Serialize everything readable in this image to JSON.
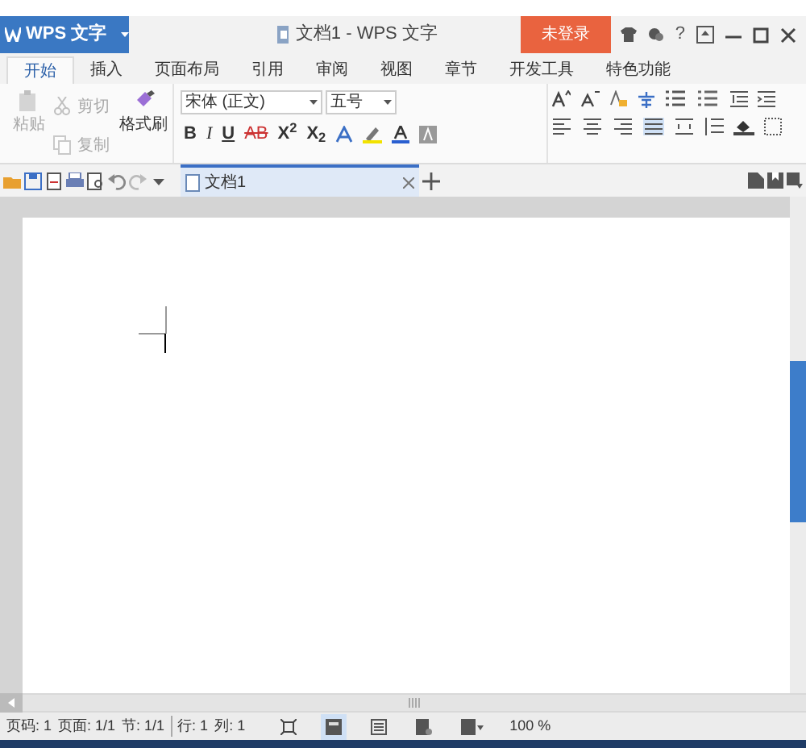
{
  "app_menu": {
    "label": "WPS 文字"
  },
  "window": {
    "title": "文档1 - WPS 文字"
  },
  "login_button": {
    "label": "未登录"
  },
  "help": {
    "label": "?"
  },
  "tabs": [
    {
      "label": "开始",
      "selected": true
    },
    {
      "label": "插入",
      "selected": false
    },
    {
      "label": "页面布局",
      "selected": false
    },
    {
      "label": "引用",
      "selected": false
    },
    {
      "label": "审阅",
      "selected": false
    },
    {
      "label": "视图",
      "selected": false
    },
    {
      "label": "章节",
      "selected": false
    },
    {
      "label": "开发工具",
      "selected": false
    },
    {
      "label": "特色功能",
      "selected": false
    }
  ],
  "clipboard": [
    {
      "kind": "paste",
      "label": "粘贴",
      "disabled": true
    },
    {
      "kind": "cut",
      "label": "剪切",
      "disabled": true
    },
    {
      "kind": "copy",
      "label": "复制",
      "disabled": true
    },
    {
      "kind": "painter",
      "label": "格式刷",
      "disabled": false
    }
  ],
  "font": {
    "name": "宋体 (正文)",
    "size": "五号"
  },
  "format_buttons": [
    {
      "label": "B",
      "kind": "bold"
    },
    {
      "label": "I",
      "kind": "italic"
    },
    {
      "label": "U",
      "kind": "underline"
    },
    {
      "label": "AB",
      "kind": "strike"
    },
    {
      "label": "X$^{2}$",
      "kind": "plain"
    },
    {
      "label": "X$_{2}$",
      "kind": "plain"
    }
  ],
  "doc_tabs": [
    {
      "label": "文档1",
      "selected": true
    }
  ],
  "status_bar": [
    "页码: 1",
    "页面: 1/1",
    "节: 1/1",
    "行: 1",
    "列: 1"
  ],
  "zoom": "100 %"
}
